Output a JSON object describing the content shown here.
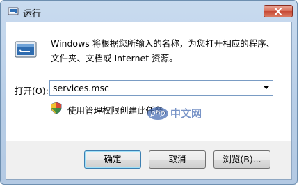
{
  "window": {
    "title": "运行",
    "close_icon": "close-icon"
  },
  "content": {
    "description_line1": "Windows 将根据您所输入的名称，为您打开相应的程序、",
    "description_line2": "文件夹、文档或 Internet 资源。",
    "open_label": "打开(O):",
    "open_value": "services.msc",
    "admin_note": "使用管理权限创建此任务。"
  },
  "buttons": {
    "ok": "确定",
    "cancel": "取消",
    "browse": "浏览(B)..."
  },
  "watermark": {
    "logo_text": "php",
    "site_text": "中文网"
  },
  "colors": {
    "frame": "#b7cde6",
    "close_button": "#d86e5a",
    "watermark": "#4a6fb5"
  }
}
